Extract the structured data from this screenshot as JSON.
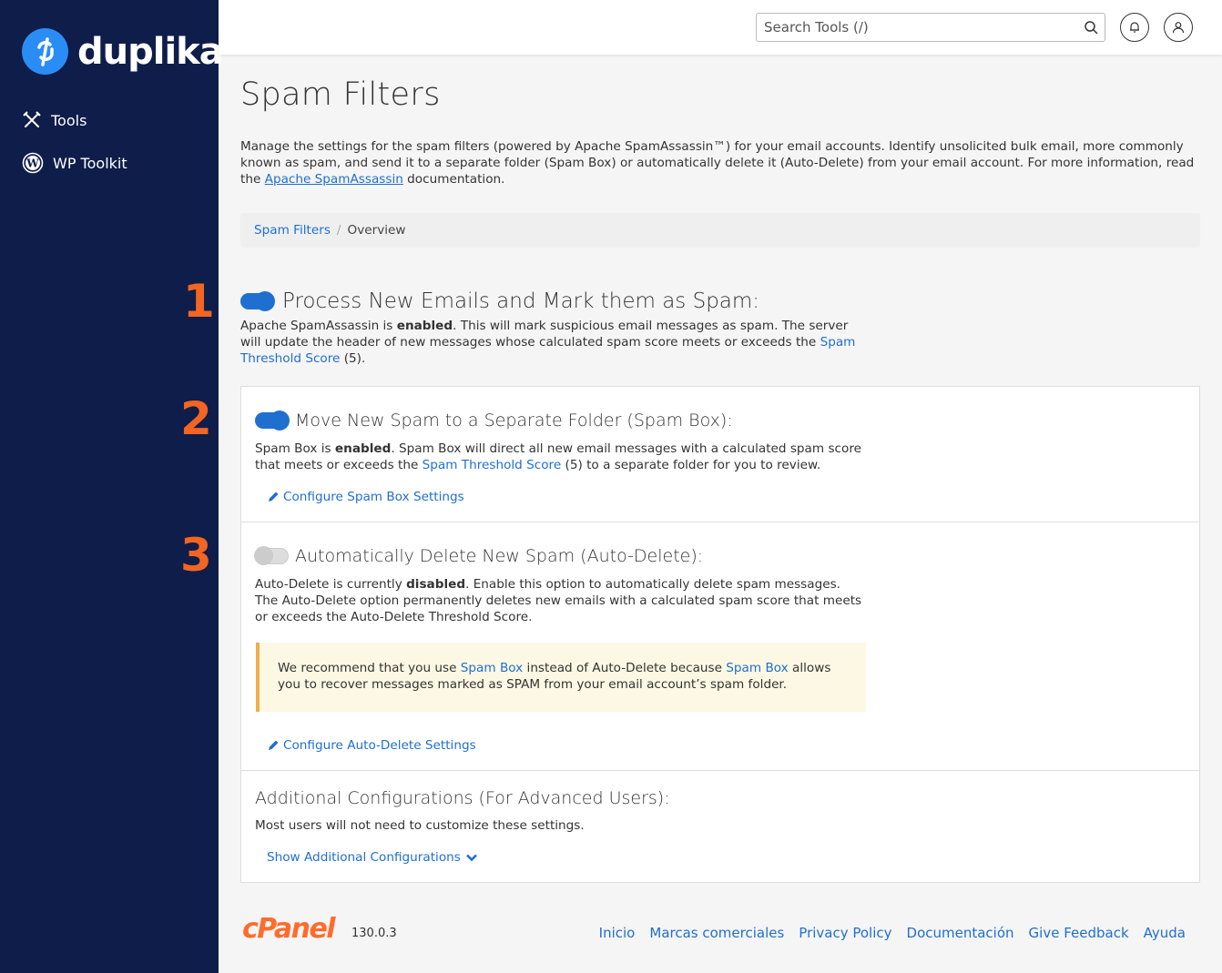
{
  "sidebar": {
    "brand": "duplika",
    "items": [
      {
        "label": "Tools",
        "icon": "tools-icon"
      },
      {
        "label": "WP Toolkit",
        "icon": "wordpress-icon"
      }
    ]
  },
  "header": {
    "search_placeholder": "Search Tools (/)"
  },
  "page": {
    "title": "Spam Filters",
    "intro_text": "Manage the settings for the spam filters (powered by Apache SpamAssassin™) for your email accounts. Identify unsolicited bulk email, more commonly known as spam, and send it to a separate folder (Spam Box) or automatically delete it (Auto-Delete) from your email account. For more information, read the ",
    "intro_link": "Apache SpamAssassin",
    "intro_suffix": " documentation."
  },
  "breadcrumb": {
    "link": "Spam Filters",
    "separator": "/",
    "current": "Overview"
  },
  "steps": [
    "1",
    "2",
    "3"
  ],
  "process": {
    "title": "Process New Emails and Mark them as Spam:",
    "enabled": true,
    "desc_a": "Apache SpamAssassin is ",
    "desc_b": "enabled",
    "desc_c": ". This will mark suspicious email messages as spam. The server will update the header of new messages whose calculated spam score meets or exceeds the ",
    "desc_link": "Spam Threshold Score",
    "desc_d": " (5)."
  },
  "spambox": {
    "title": "Move New Spam to a Separate Folder (Spam Box):",
    "enabled": true,
    "desc_a": "Spam Box is ",
    "desc_b": "enabled",
    "desc_c": ". Spam Box will direct all new email messages with a calculated spam score that meets or exceeds the ",
    "desc_link": "Spam Threshold Score",
    "desc_d": " (5) to a separate folder for you to review.",
    "config_link": "Configure Spam Box Settings"
  },
  "autodelete": {
    "title": "Automatically Delete New Spam (Auto-Delete):",
    "enabled": false,
    "desc_a": "Auto-Delete is currently ",
    "desc_b": "disabled",
    "desc_c": ". Enable this option to automatically delete spam messages. The Auto-Delete option permanently deletes new emails with a calculated spam score that meets or exceeds the Auto-Delete Threshold Score.",
    "alert_a": "We recommend that you use ",
    "alert_link1": "Spam Box",
    "alert_b": " instead of Auto-Delete because ",
    "alert_link2": "Spam Box",
    "alert_c": " allows you to recover messages marked as SPAM from your email account’s spam folder.",
    "config_link": "Configure Auto-Delete Settings"
  },
  "additional": {
    "title": "Additional Configurations (For Advanced Users):",
    "desc": "Most users will not need to customize these settings.",
    "toggle_link": "Show Additional Configurations"
  },
  "footer": {
    "logo": "cPanel",
    "version": "130.0.3",
    "links": [
      "Inicio",
      "Marcas comerciales",
      "Privacy Policy",
      "Documentación",
      "Give Feedback",
      "Ayuda"
    ]
  },
  "colors": {
    "sidebar_bg": "#0f1d4a",
    "accent": "#1f6fd1",
    "step_number": "#f26522",
    "cpanel_orange": "#ff6c2c",
    "alert_bg": "#fcf8e3",
    "alert_border": "#f0ad4e"
  }
}
